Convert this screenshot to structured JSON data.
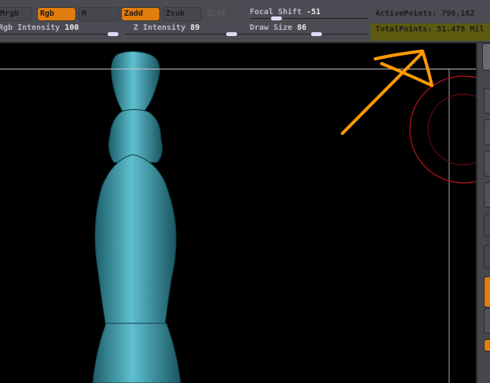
{
  "toolbar": {
    "buttons": [
      {
        "label": "Mrgb",
        "active": false
      },
      {
        "label": "Rgb",
        "active": true
      },
      {
        "label": "M",
        "active": false
      },
      {
        "label": "Zadd",
        "active": true
      },
      {
        "label": "Zsub",
        "active": false
      },
      {
        "label": "Zcut",
        "active": false,
        "disabled": true
      }
    ],
    "sliders": [
      {
        "label": "Rgb Intensity",
        "value": "100",
        "fraction": 1.0
      },
      {
        "label": "Z Intensity",
        "value": "89",
        "fraction": 0.89
      },
      {
        "label": "Focal Shift",
        "value": "-51",
        "fraction": 0.25
      },
      {
        "label": "Draw Size",
        "value": "86",
        "fraction": 0.52
      }
    ],
    "active_points": "ActivePoints: 796,162",
    "total_points": "TotalPoints: 51.478 Mil"
  },
  "colors": {
    "accent": "#e07d0c",
    "highlight": "#5d5a10",
    "model": "#3fa7b8",
    "annotation": "#ff9a00",
    "brush_ring": "#c0101a"
  }
}
